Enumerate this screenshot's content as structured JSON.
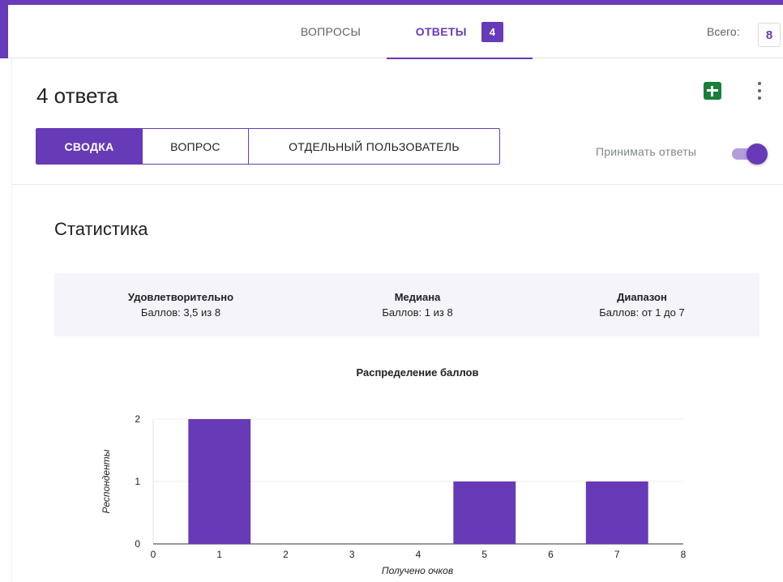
{
  "tabs": {
    "questions_label": "ВОПРОСЫ",
    "answers_label": "ОТВЕТЫ",
    "answers_count": "4",
    "total_label": "Всего:",
    "total_value": "8"
  },
  "header": {
    "title": "4 ответа",
    "sheets_icon": "sheets-icon",
    "more_icon": "more-vert-icon"
  },
  "view_selector": {
    "summary": "СВОДКА",
    "question": "ВОПРОС",
    "individual": "ОТДЕЛЬНЫЙ ПОЛЬЗОВАТЕЛЬ",
    "selected": "summary"
  },
  "accepting": {
    "label": "Принимать ответы",
    "on": true
  },
  "stats": {
    "title": "Статистика",
    "items": [
      {
        "name": "Удовлетворительно",
        "value": "Баллов: 3,5 из 8"
      },
      {
        "name": "Медиана",
        "value": "Баллов: 1 из 8"
      },
      {
        "name": "Диапазон",
        "value": "Баллов: от 1 до 7"
      }
    ]
  },
  "colors": {
    "accent": "#673ab7",
    "accent_light": "#b39ddb",
    "sheets_green": "#188038"
  },
  "chart_data": {
    "type": "bar",
    "title": "Распределение баллов",
    "xlabel": "Получено очков",
    "ylabel": "Респонденты",
    "x_ticks": [
      "0",
      "1",
      "2",
      "3",
      "4",
      "5",
      "6",
      "7",
      "8"
    ],
    "y_ticks": [
      "0",
      "1",
      "2"
    ],
    "x": [
      1,
      5,
      7
    ],
    "values": [
      2,
      1,
      1
    ],
    "xlim": [
      0,
      8
    ],
    "ylim": [
      0,
      2
    ],
    "grid": true,
    "color": "#673ab7"
  }
}
